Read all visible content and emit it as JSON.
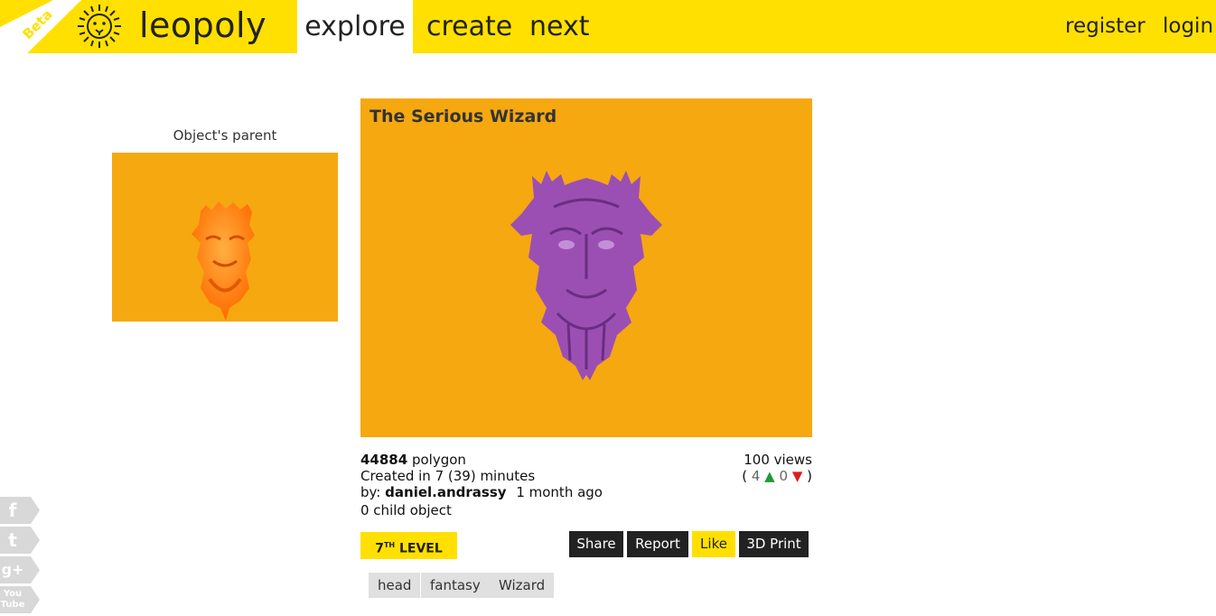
{
  "header": {
    "beta_label": "Beta",
    "logo_text": "leopoly",
    "nav": {
      "explore": "explore",
      "create": "create",
      "next": "next"
    },
    "auth": {
      "register": "register",
      "login": "login"
    }
  },
  "parent": {
    "title": "Object's parent"
  },
  "object": {
    "title": "The Serious Wizard",
    "polygon_count": "44884",
    "polygon_label": "polygon",
    "created_label": "Created in 7 (39) minutes",
    "by_label": "by:",
    "author": "daniel.andrassy",
    "age": "1 month ago",
    "children": "0 child object",
    "views": "100 views",
    "votes_open": "(",
    "votes_up": "4",
    "votes_down": "0",
    "votes_close": ")",
    "level_num": "7",
    "level_sup": "TH",
    "level_word": "LEVEL"
  },
  "actions": {
    "share": "Share",
    "report": "Report",
    "like": "Like",
    "print": "3D Print"
  },
  "tags": [
    "head",
    "fantasy",
    "Wizard"
  ],
  "social": {
    "facebook": "f",
    "twitter": "t",
    "googleplus": "g+",
    "youtube": "You Tube"
  },
  "colors": {
    "accent": "#ffe000",
    "viewer_bg": "#f5a810",
    "dark_button": "#222222",
    "model_purple": "#9b4fb3",
    "model_orange": "#ff7a10"
  }
}
